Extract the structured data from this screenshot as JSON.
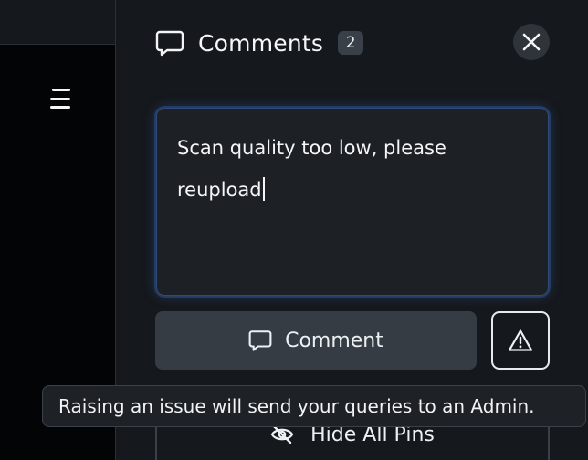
{
  "sidebar": {
    "menu_icon": "hamburger-menu-icon"
  },
  "comments_panel": {
    "title": "Comments",
    "count": "2",
    "title_icon": "chat-bubble-icon",
    "close_icon": "close-icon",
    "input": {
      "value": "Scan quality too low, please reupload"
    },
    "comment_button": {
      "label": "Comment",
      "icon": "chat-bubble-icon"
    },
    "raise_issue_button": {
      "icon": "warning-triangle-icon"
    },
    "hide_pins_button": {
      "label": "Hide All Pins",
      "icon": "eye-slash-icon"
    }
  },
  "tooltip": {
    "text": "Raising an issue will send your queries to an Admin."
  },
  "colors": {
    "panel_bg": "#15181c",
    "input_focus_ring": "#3a66b4",
    "button_bg": "#363c44"
  }
}
